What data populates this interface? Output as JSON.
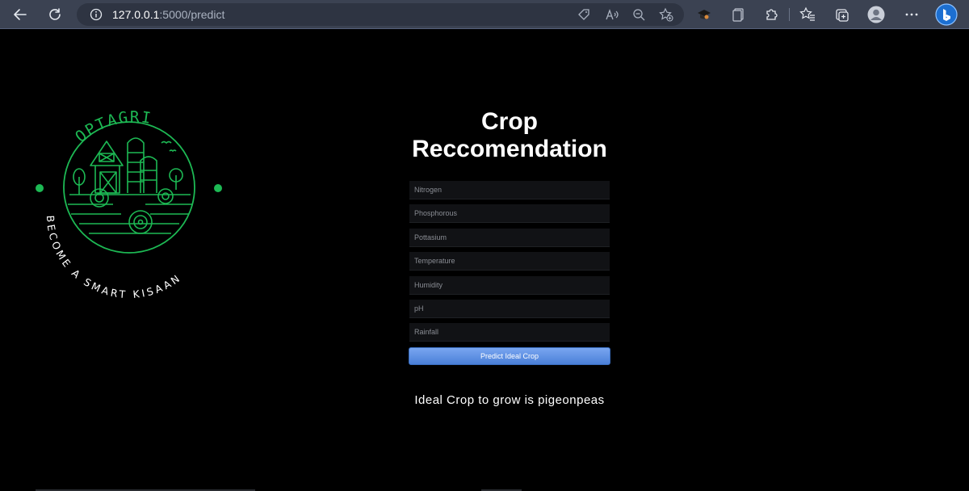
{
  "browser": {
    "url_host": "127.0.0.1",
    "url_path": ":5000/predict"
  },
  "logo": {
    "brand": "OPTAGRI",
    "tagline": "BECOME A SMART KISAAN",
    "accent_color": "#1db954"
  },
  "main": {
    "title_line1": "Crop",
    "title_line2": "Reccomendation",
    "fields": [
      {
        "placeholder": "Nitrogen"
      },
      {
        "placeholder": "Phosphorous"
      },
      {
        "placeholder": "Pottasium"
      },
      {
        "placeholder": "Temperature"
      },
      {
        "placeholder": "Humidity"
      },
      {
        "placeholder": "pH"
      },
      {
        "placeholder": "Rainfall"
      }
    ],
    "predict_label": "Predict Ideal Crop",
    "result_text": "Ideal Crop to grow is pigeonpeas"
  }
}
